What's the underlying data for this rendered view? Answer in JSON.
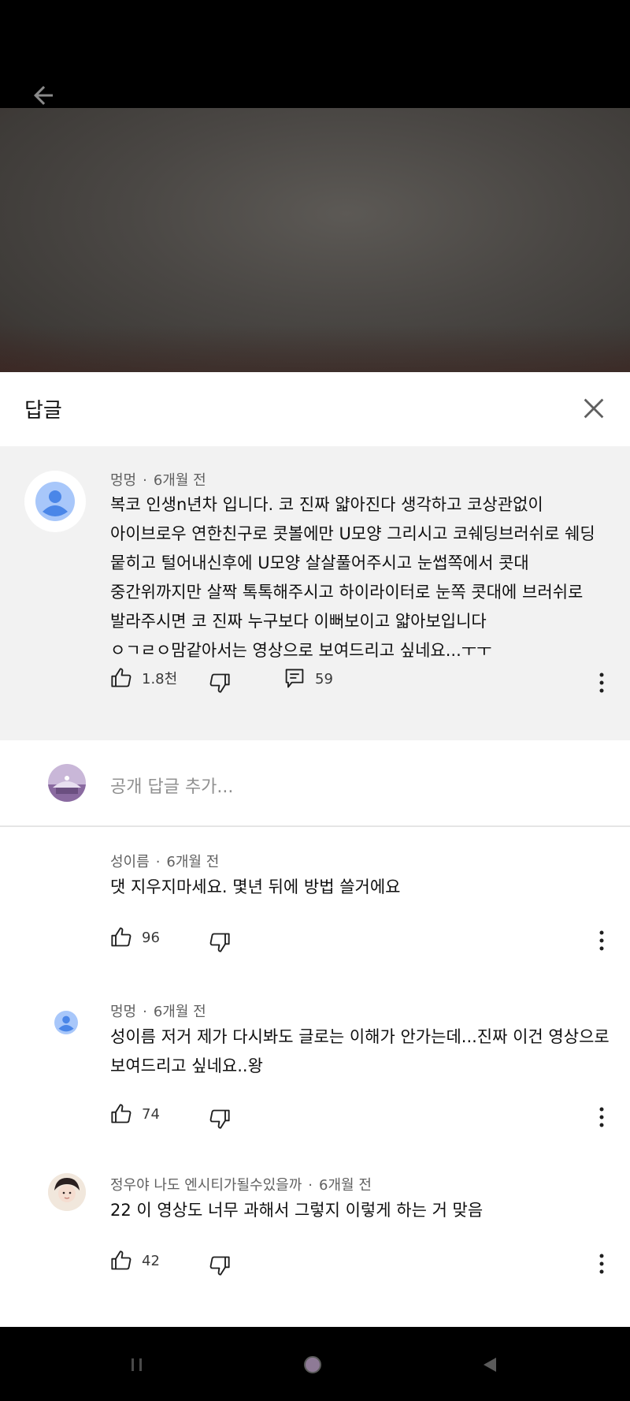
{
  "panel": {
    "title": "답글",
    "close_icon": "close-icon"
  },
  "parent_comment": {
    "author": "멍멍",
    "time": "6개월 전",
    "text": "복코 인생n년차 입니다. 코 진짜 얇아진다 생각하고 코상관없이\n아이브로우 연한친구로 콧볼에만 U모양 그리시고 코쉐딩브러쉬로 쉐딩\n뭍히고 털어내신후에 U모양  살살풀어주시고 눈썹쪽에서 콧대\n중간위까지만 살짝 톡톡해주시고 하이라이터로 눈쪽 콧대에 브러쉬로\n발라주시면 코 진짜 누구보다 이뻐보이고 얇아보입니다\nㅇㄱㄹㅇ맘같아서는 영상으로 보여드리고 싶네요...ㅜㅜ",
    "likes": "1.8천",
    "replies": "59"
  },
  "reply_input": {
    "placeholder": "공개 답글 추가..."
  },
  "replies": [
    {
      "author": "성이름",
      "time": "6개월 전",
      "text": "댓 지우지마세요. 몇년 뒤에 방법 쓸거에요",
      "likes": "96"
    },
    {
      "author": "멍멍",
      "time": "6개월 전",
      "text": "성이름 저거 제가 다시봐도 글로는 이해가 안가는데...진짜 이건 영상으로\n보여드리고 싶네요..왕",
      "likes": "74"
    },
    {
      "author": "정우야 나도 엔시티가될수있을까",
      "time": "6개월 전",
      "text": "22 이 영상도 너무 과해서 그렇지 이렇게 하는 거 맞음",
      "likes": "42"
    }
  ],
  "colors": {
    "accent_avatar": "#a8c7fa",
    "avatar_figure": "#4a86e8",
    "panel_bg": "#ffffff",
    "highlight_bg": "#f2f2f2"
  }
}
